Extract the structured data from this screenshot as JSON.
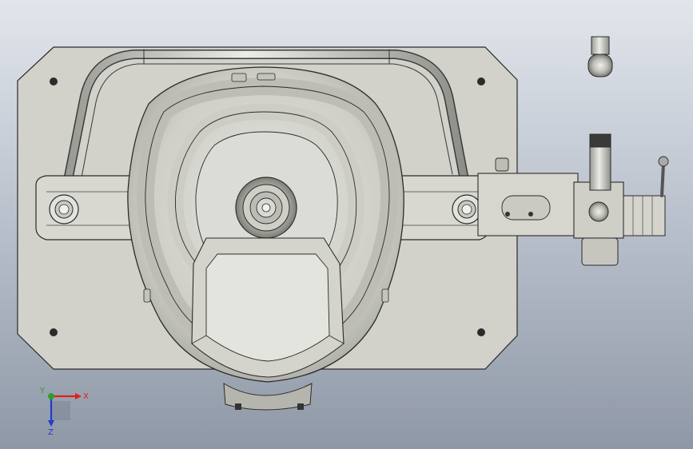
{
  "viewport": {
    "background_top": "#e2e6ec",
    "background_bottom": "#8f98a6",
    "plate_color": "#d2d1ca",
    "edge_color": "#2a2a2a"
  },
  "triad": {
    "x_label": "X",
    "y_label": "Y",
    "z_label": "Z",
    "x_color": "#e0201c",
    "y_color": "#2ca02c",
    "z_color": "#1f3ccf"
  }
}
